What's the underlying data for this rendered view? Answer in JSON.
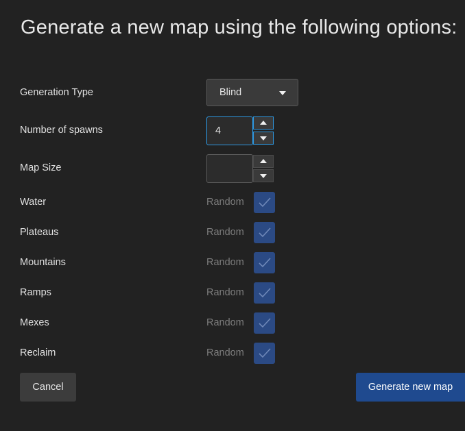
{
  "title": "Generate a new map using the following options:",
  "generation_type": {
    "label": "Generation Type",
    "selected": "Blind"
  },
  "spawns": {
    "label": "Number of spawns",
    "value": "4"
  },
  "map_size": {
    "label": "Map Size",
    "value": ""
  },
  "options": [
    {
      "label": "Water",
      "random_label": "Random",
      "checked": true
    },
    {
      "label": "Plateaus",
      "random_label": "Random",
      "checked": true
    },
    {
      "label": "Mountains",
      "random_label": "Random",
      "checked": true
    },
    {
      "label": "Ramps",
      "random_label": "Random",
      "checked": true
    },
    {
      "label": "Mexes",
      "random_label": "Random",
      "checked": true
    },
    {
      "label": "Reclaim",
      "random_label": "Random",
      "checked": true
    }
  ],
  "buttons": {
    "cancel": "Cancel",
    "generate": "Generate new map"
  },
  "colors": {
    "background": "#222222",
    "accent": "#1f4a8f",
    "focus": "#2e9be6",
    "checkbox": "#2b4a84"
  }
}
